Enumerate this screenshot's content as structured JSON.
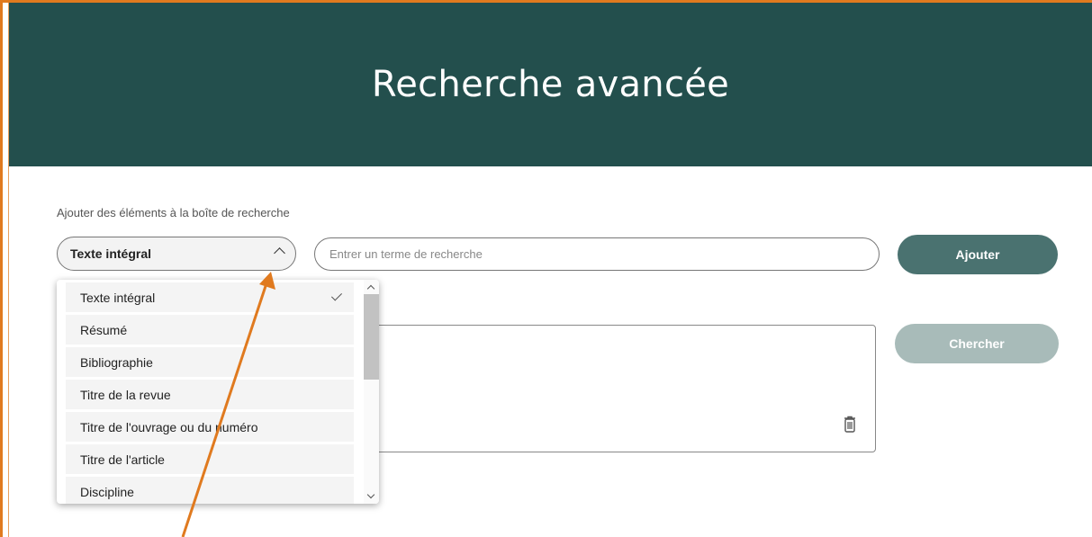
{
  "header": {
    "title": "Recherche avancée"
  },
  "form": {
    "label": "Ajouter des éléments à la boîte de recherche",
    "field_selected": "Texte intégral",
    "search_placeholder": "Entrer un terme de recherche",
    "add_label": "Ajouter",
    "search_label": "Chercher"
  },
  "dropdown": {
    "selected_index": 0,
    "items": [
      {
        "label": "Texte intégral"
      },
      {
        "label": "Résumé"
      },
      {
        "label": "Bibliographie"
      },
      {
        "label": "Titre de la revue"
      },
      {
        "label": "Titre de l'ouvrage ou du numéro"
      },
      {
        "label": "Titre de l'article"
      },
      {
        "label": "Discipline"
      }
    ]
  },
  "colors": {
    "header_bg": "#234f4d",
    "annotation_arrow": "#e07a1f",
    "add_button": "#4a7270",
    "search_button_disabled": "#a8bbb9"
  },
  "icons": [
    "chevron-up-icon",
    "check-icon",
    "trash-icon",
    "scroll-up-icon",
    "scroll-down-icon"
  ]
}
